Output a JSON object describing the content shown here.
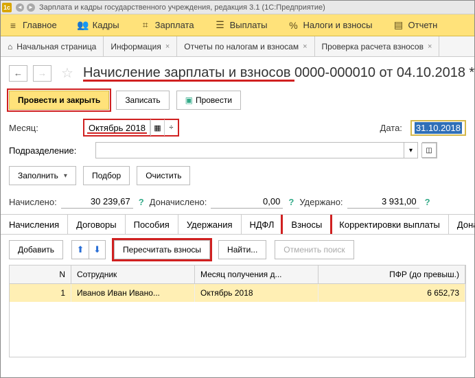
{
  "window": {
    "title": "Зарплата и кадры государственного учреждения, редакция 3.1  (1С:Предприятие)",
    "logo_text": "1с"
  },
  "main_menu": {
    "home": "Главное",
    "kadry": "Кадры",
    "zarplata": "Зарплата",
    "vyplaty": "Выплаты",
    "nalogi": "Налоги и взносы",
    "otchet": "Отчетн"
  },
  "tabs": {
    "start": "Начальная страница",
    "info": "Информация",
    "reports": "Отчеты по налогам и взносам",
    "check": "Проверка расчета взносов"
  },
  "doc": {
    "title_part1": "Начисление зарплаты и взносов",
    "title_part2": " 0000-000010 от 04.10.2018 *"
  },
  "buttons": {
    "post_close": "Провести и закрыть",
    "save": "Записать",
    "post": "Провести",
    "fill": "Заполнить",
    "select": "Подбор",
    "clear": "Очистить",
    "add": "Добавить",
    "recalc": "Пересчитать взносы",
    "find": "Найти...",
    "cancel_find": "Отменить поиск"
  },
  "form": {
    "month_label": "Месяц:",
    "month_value": "Октябрь 2018",
    "date_label": "Дата:",
    "date_value": "31.10.2018",
    "podr_label": "Подразделение:",
    "podr_value": ""
  },
  "sums": {
    "accrued_label": "Начислено:",
    "accrued_value": "30 239,67",
    "addl_label": "Доначислено:",
    "addl_value": "0,00",
    "withheld_label": "Удержано:",
    "withheld_value": "3 931,00"
  },
  "inner_tabs": {
    "accruals": "Начисления",
    "contracts": "Договоры",
    "benefits": "Пособия",
    "deductions": "Удержания",
    "ndfl": "НДФЛ",
    "vznosy": "Взносы",
    "corrections": "Корректировки выплаты",
    "donach": "Донач"
  },
  "grid": {
    "col_n": "N",
    "col_emp": "Сотрудник",
    "col_month": "Месяц получения д...",
    "col_pfr": "ПФР (до превыш.)",
    "row1": {
      "n": "1",
      "emp": "Иванов Иван Ивано...",
      "month": "Октябрь 2018",
      "pfr": "6 652,73"
    }
  }
}
